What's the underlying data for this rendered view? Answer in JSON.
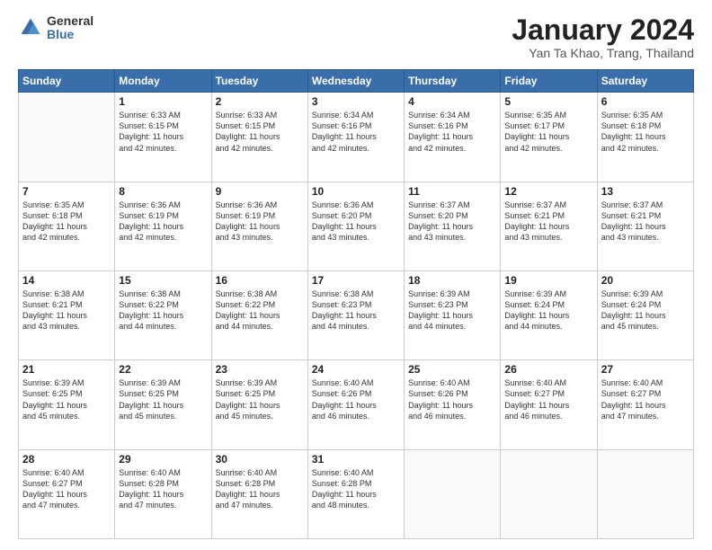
{
  "logo": {
    "general": "General",
    "blue": "Blue"
  },
  "title": {
    "month_year": "January 2024",
    "location": "Yan Ta Khao, Trang, Thailand"
  },
  "header_days": [
    "Sunday",
    "Monday",
    "Tuesday",
    "Wednesday",
    "Thursday",
    "Friday",
    "Saturday"
  ],
  "weeks": [
    [
      {
        "day": "",
        "detail": ""
      },
      {
        "day": "1",
        "detail": "Sunrise: 6:33 AM\nSunset: 6:15 PM\nDaylight: 11 hours\nand 42 minutes."
      },
      {
        "day": "2",
        "detail": "Sunrise: 6:33 AM\nSunset: 6:15 PM\nDaylight: 11 hours\nand 42 minutes."
      },
      {
        "day": "3",
        "detail": "Sunrise: 6:34 AM\nSunset: 6:16 PM\nDaylight: 11 hours\nand 42 minutes."
      },
      {
        "day": "4",
        "detail": "Sunrise: 6:34 AM\nSunset: 6:16 PM\nDaylight: 11 hours\nand 42 minutes."
      },
      {
        "day": "5",
        "detail": "Sunrise: 6:35 AM\nSunset: 6:17 PM\nDaylight: 11 hours\nand 42 minutes."
      },
      {
        "day": "6",
        "detail": "Sunrise: 6:35 AM\nSunset: 6:18 PM\nDaylight: 11 hours\nand 42 minutes."
      }
    ],
    [
      {
        "day": "7",
        "detail": "Sunrise: 6:35 AM\nSunset: 6:18 PM\nDaylight: 11 hours\nand 42 minutes."
      },
      {
        "day": "8",
        "detail": "Sunrise: 6:36 AM\nSunset: 6:19 PM\nDaylight: 11 hours\nand 42 minutes."
      },
      {
        "day": "9",
        "detail": "Sunrise: 6:36 AM\nSunset: 6:19 PM\nDaylight: 11 hours\nand 43 minutes."
      },
      {
        "day": "10",
        "detail": "Sunrise: 6:36 AM\nSunset: 6:20 PM\nDaylight: 11 hours\nand 43 minutes."
      },
      {
        "day": "11",
        "detail": "Sunrise: 6:37 AM\nSunset: 6:20 PM\nDaylight: 11 hours\nand 43 minutes."
      },
      {
        "day": "12",
        "detail": "Sunrise: 6:37 AM\nSunset: 6:21 PM\nDaylight: 11 hours\nand 43 minutes."
      },
      {
        "day": "13",
        "detail": "Sunrise: 6:37 AM\nSunset: 6:21 PM\nDaylight: 11 hours\nand 43 minutes."
      }
    ],
    [
      {
        "day": "14",
        "detail": "Sunrise: 6:38 AM\nSunset: 6:21 PM\nDaylight: 11 hours\nand 43 minutes."
      },
      {
        "day": "15",
        "detail": "Sunrise: 6:38 AM\nSunset: 6:22 PM\nDaylight: 11 hours\nand 44 minutes."
      },
      {
        "day": "16",
        "detail": "Sunrise: 6:38 AM\nSunset: 6:22 PM\nDaylight: 11 hours\nand 44 minutes."
      },
      {
        "day": "17",
        "detail": "Sunrise: 6:38 AM\nSunset: 6:23 PM\nDaylight: 11 hours\nand 44 minutes."
      },
      {
        "day": "18",
        "detail": "Sunrise: 6:39 AM\nSunset: 6:23 PM\nDaylight: 11 hours\nand 44 minutes."
      },
      {
        "day": "19",
        "detail": "Sunrise: 6:39 AM\nSunset: 6:24 PM\nDaylight: 11 hours\nand 44 minutes."
      },
      {
        "day": "20",
        "detail": "Sunrise: 6:39 AM\nSunset: 6:24 PM\nDaylight: 11 hours\nand 45 minutes."
      }
    ],
    [
      {
        "day": "21",
        "detail": "Sunrise: 6:39 AM\nSunset: 6:25 PM\nDaylight: 11 hours\nand 45 minutes."
      },
      {
        "day": "22",
        "detail": "Sunrise: 6:39 AM\nSunset: 6:25 PM\nDaylight: 11 hours\nand 45 minutes."
      },
      {
        "day": "23",
        "detail": "Sunrise: 6:39 AM\nSunset: 6:25 PM\nDaylight: 11 hours\nand 45 minutes."
      },
      {
        "day": "24",
        "detail": "Sunrise: 6:40 AM\nSunset: 6:26 PM\nDaylight: 11 hours\nand 46 minutes."
      },
      {
        "day": "25",
        "detail": "Sunrise: 6:40 AM\nSunset: 6:26 PM\nDaylight: 11 hours\nand 46 minutes."
      },
      {
        "day": "26",
        "detail": "Sunrise: 6:40 AM\nSunset: 6:27 PM\nDaylight: 11 hours\nand 46 minutes."
      },
      {
        "day": "27",
        "detail": "Sunrise: 6:40 AM\nSunset: 6:27 PM\nDaylight: 11 hours\nand 47 minutes."
      }
    ],
    [
      {
        "day": "28",
        "detail": "Sunrise: 6:40 AM\nSunset: 6:27 PM\nDaylight: 11 hours\nand 47 minutes."
      },
      {
        "day": "29",
        "detail": "Sunrise: 6:40 AM\nSunset: 6:28 PM\nDaylight: 11 hours\nand 47 minutes."
      },
      {
        "day": "30",
        "detail": "Sunrise: 6:40 AM\nSunset: 6:28 PM\nDaylight: 11 hours\nand 47 minutes."
      },
      {
        "day": "31",
        "detail": "Sunrise: 6:40 AM\nSunset: 6:28 PM\nDaylight: 11 hours\nand 48 minutes."
      },
      {
        "day": "",
        "detail": ""
      },
      {
        "day": "",
        "detail": ""
      },
      {
        "day": "",
        "detail": ""
      }
    ]
  ]
}
